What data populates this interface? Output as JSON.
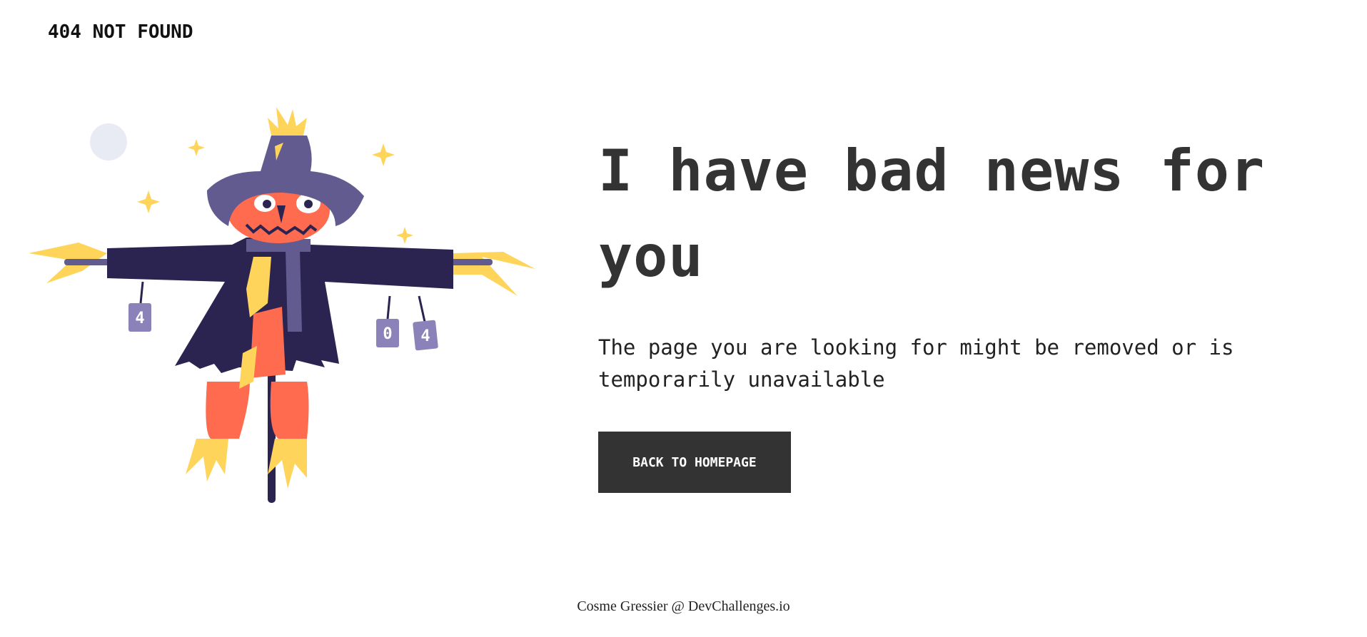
{
  "header": {
    "title": "404 NOT FOUND"
  },
  "illustration": {
    "name": "scarecrow-illustration",
    "can_labels": [
      "4",
      "0",
      "4"
    ],
    "colors": {
      "hat": "#625B8F",
      "coat": "#2B2350",
      "face": "#FF6B4F",
      "straw": "#FFD45B",
      "moon": "#E8EBF4",
      "pole": "#2B2350"
    }
  },
  "main": {
    "headline": "I have bad news for you",
    "message": "The page you are looking for might be removed or is temporarily unavailable",
    "button_label": "BACK TO HOMEPAGE"
  },
  "footer": {
    "credit": "Cosme Gressier @ DevChallenges.io"
  },
  "colors": {
    "text_dark": "#333333",
    "button_bg": "#333333",
    "button_text": "#FFFFFF",
    "background": "#FFFFFF"
  }
}
